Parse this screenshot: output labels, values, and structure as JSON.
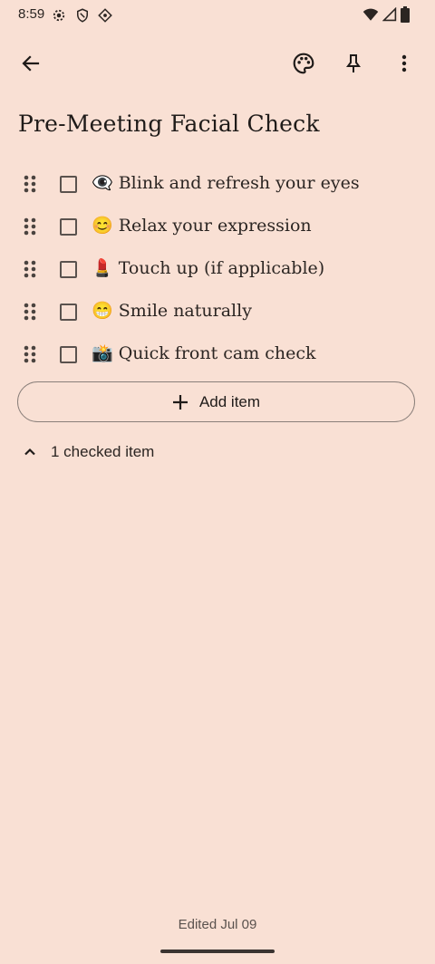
{
  "status_bar": {
    "time": "8:59",
    "left_icons": [
      "settings-icon",
      "shield-icon",
      "data-saver-icon"
    ],
    "right_icons": [
      "wifi-icon",
      "signal-icon",
      "battery-icon"
    ]
  },
  "toolbar": {
    "back_icon": "arrow-back-icon",
    "palette_icon": "palette-icon",
    "pin_icon": "pin-icon",
    "more_icon": "more-vert-icon"
  },
  "note": {
    "title": "Pre-Meeting Facial Check",
    "items": [
      {
        "emoji": "👁️‍🗨️",
        "text": "Blink and refresh your eyes",
        "checked": false
      },
      {
        "emoji": "😊",
        "text": "Relax your expression",
        "checked": false
      },
      {
        "emoji": "💄",
        "text": "Touch up (if applicable)",
        "checked": false
      },
      {
        "emoji": "😁",
        "text": "Smile naturally",
        "checked": false
      },
      {
        "emoji": "📸",
        "text": "Quick front cam check",
        "checked": false
      }
    ],
    "add_item_label": "Add item",
    "checked_summary": "1 checked item",
    "edited_label": "Edited Jul 09"
  },
  "colors": {
    "background": "#f9e0d4",
    "text": "#1f1b19",
    "outline": "#8a7f7a"
  }
}
